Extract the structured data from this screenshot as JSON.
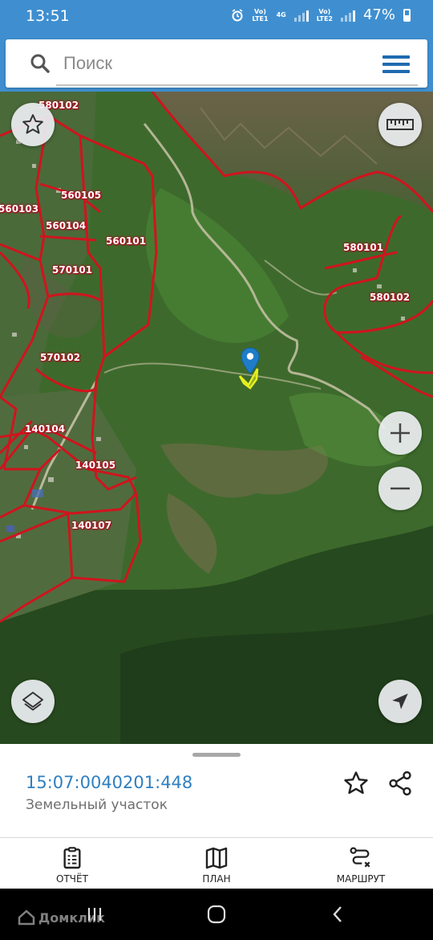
{
  "status_bar": {
    "time": "13:51",
    "sim1": "Vo)\nLTE1",
    "net_type": "4G",
    "sim2": "Vo)\nLTE2",
    "battery": "47%"
  },
  "search": {
    "placeholder": "Поиск",
    "icon": "search-icon",
    "menu_icon": "hamburger-menu-icon"
  },
  "map": {
    "boundary_color": "#d0141e",
    "selected_parcel_color": "#e6f01e",
    "marker_color": "#1f7dc8",
    "parcel_labels": [
      "580102",
      "560105",
      "560103",
      "560104",
      "560101",
      "570101",
      "570102",
      "140104",
      "140105",
      "140107",
      "580101",
      "580102"
    ],
    "controls": {
      "favorite": "star-icon",
      "ruler": "ruler-icon",
      "zoom_in": "plus-icon",
      "zoom_out": "minus-icon",
      "layers": "layers-icon",
      "locate": "navigation-arrow-icon"
    }
  },
  "parcel_card": {
    "cadastral_number": "15:07:0040201:448",
    "type": "Земельный участок",
    "favorite_icon": "star-outline-icon",
    "share_icon": "share-icon"
  },
  "tabs": [
    {
      "label": "ОТЧЁТ",
      "icon": "report-clipboard-icon"
    },
    {
      "label": "ПЛАН",
      "icon": "map-plan-icon"
    },
    {
      "label": "МАРШРУТ",
      "icon": "route-icon"
    }
  ],
  "nav_bar": {
    "watermark": "Домклик"
  }
}
